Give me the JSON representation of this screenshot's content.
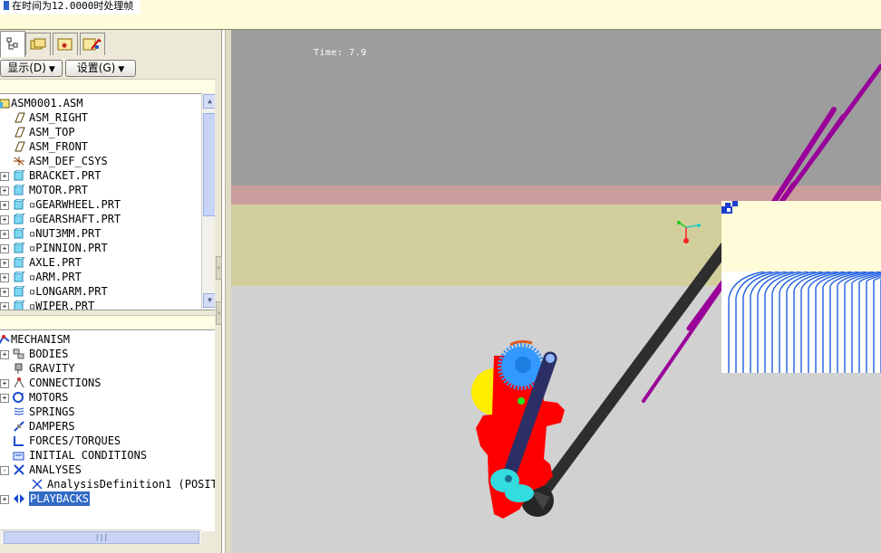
{
  "status_bar": {
    "message": "在时间为12.0000时处理帧"
  },
  "left_panel": {
    "tabs": [
      {
        "name": "model-tree",
        "icon": "model-tree-icon",
        "active": true
      },
      {
        "name": "folder-browser",
        "icon": "folder-icon",
        "active": false
      },
      {
        "name": "favorites",
        "icon": "favorites-icon",
        "active": false
      },
      {
        "name": "connections",
        "icon": "connections-icon",
        "active": false
      }
    ],
    "display_button": "显示(D)",
    "settings_button": "设置(G)",
    "model_tree": [
      {
        "label": "ASM0001.ASM",
        "icon": "assembly-icon",
        "level": 0,
        "expander": ""
      },
      {
        "label": "ASM_RIGHT",
        "icon": "datum-plane-icon",
        "level": 1,
        "expander": ""
      },
      {
        "label": "ASM_TOP",
        "icon": "datum-plane-icon",
        "level": 1,
        "expander": ""
      },
      {
        "label": "ASM_FRONT",
        "icon": "datum-plane-icon",
        "level": 1,
        "expander": ""
      },
      {
        "label": "ASM_DEF_CSYS",
        "icon": "coordinate-system-icon",
        "level": 1,
        "expander": ""
      },
      {
        "label": "BRACKET.PRT",
        "icon": "part-icon",
        "level": 1,
        "expander": "+"
      },
      {
        "label": "MOTOR.PRT",
        "icon": "part-icon",
        "level": 1,
        "expander": "+"
      },
      {
        "label": "▫GEARWHEEL.PRT",
        "icon": "part-icon",
        "level": 1,
        "expander": "+"
      },
      {
        "label": "▫GEARSHAFT.PRT",
        "icon": "part-icon",
        "level": 1,
        "expander": "+"
      },
      {
        "label": "▫NUT3MM.PRT",
        "icon": "part-icon",
        "level": 1,
        "expander": "+"
      },
      {
        "label": "▫PINNION.PRT",
        "icon": "part-icon",
        "level": 1,
        "expander": "+"
      },
      {
        "label": "AXLE.PRT",
        "icon": "part-icon",
        "level": 1,
        "expander": "+"
      },
      {
        "label": "▫ARM.PRT",
        "icon": "part-icon",
        "level": 1,
        "expander": "+"
      },
      {
        "label": "▫LONGARM.PRT",
        "icon": "part-icon",
        "level": 1,
        "expander": "+"
      },
      {
        "label": "▫WIPER.PRT",
        "icon": "part-icon",
        "level": 1,
        "expander": "+"
      }
    ],
    "mechanism_tree": [
      {
        "label": "MECHANISM",
        "icon": "mechanism-icon",
        "level": 0,
        "expander": "",
        "selected": false
      },
      {
        "label": "BODIES",
        "icon": "bodies-icon",
        "level": 1,
        "expander": "+",
        "selected": false
      },
      {
        "label": "GRAVITY",
        "icon": "gravity-icon",
        "level": 1,
        "expander": "",
        "selected": false
      },
      {
        "label": "CONNECTIONS",
        "icon": "connections-icon",
        "level": 1,
        "expander": "+",
        "selected": false
      },
      {
        "label": "MOTORS",
        "icon": "motors-icon",
        "level": 1,
        "expander": "+",
        "selected": false
      },
      {
        "label": "SPRINGS",
        "icon": "springs-icon",
        "level": 1,
        "expander": "",
        "selected": false
      },
      {
        "label": "DAMPERS",
        "icon": "dampers-icon",
        "level": 1,
        "expander": "",
        "selected": false
      },
      {
        "label": "FORCES/TORQUES",
        "icon": "forces-icon",
        "level": 1,
        "expander": "",
        "selected": false
      },
      {
        "label": "INITIAL CONDITIONS",
        "icon": "initial-conditions-icon",
        "level": 1,
        "expander": "",
        "selected": false
      },
      {
        "label": "ANALYSES",
        "icon": "analyses-icon",
        "level": 1,
        "expander": "-",
        "selected": false
      },
      {
        "label": "AnalysisDefinition1 (POSITI",
        "icon": "analysis-definition-icon",
        "level": 2,
        "expander": "",
        "selected": false
      },
      {
        "label": "PLAYBACKS",
        "icon": "playbacks-icon",
        "level": 1,
        "expander": "+",
        "selected": true
      }
    ]
  },
  "viewport": {
    "time_label": "Time: 7.9",
    "colors": {
      "sky": "#9d9d9d",
      "wall_stripe": "#cc9d9d",
      "wall": "#d2ce9c",
      "floor": "#d1d1d1",
      "bracket": "#ff0000",
      "gear": "#3399ff",
      "arm": "#2b2f66",
      "long_arm": "#2e2e2e",
      "wiper": "#990099",
      "yellow_part": "#ffee00",
      "cyan_part": "#33dddd"
    }
  }
}
